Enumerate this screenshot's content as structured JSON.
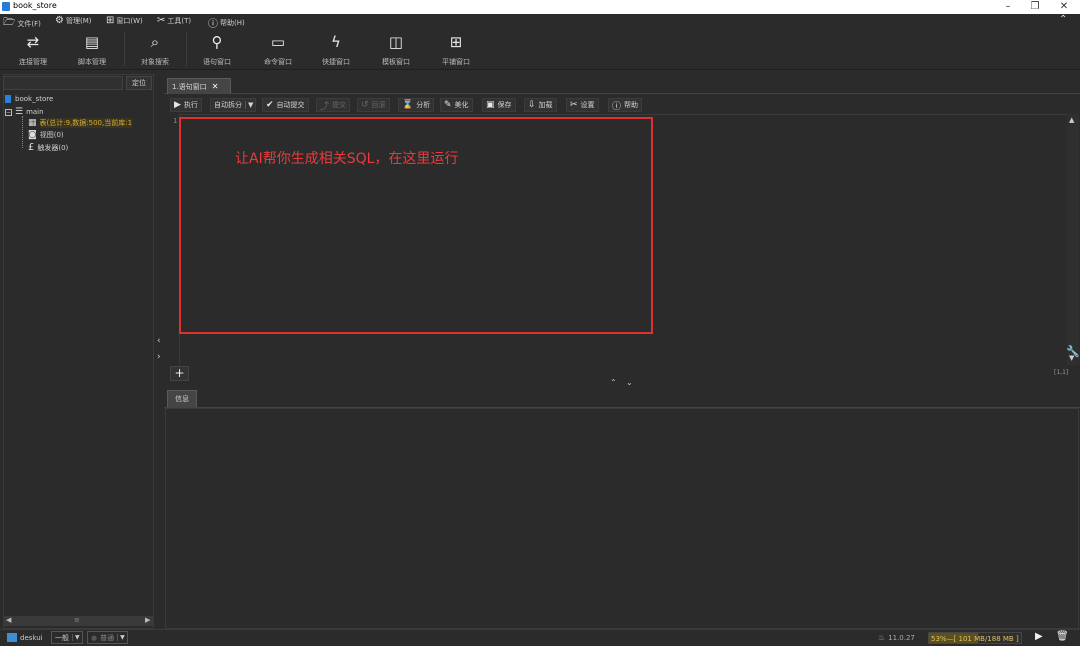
{
  "window": {
    "title": "book_store"
  },
  "menu": [
    {
      "icon": "folder-icon",
      "glyph": "🗁",
      "label": "文件(F)"
    },
    {
      "icon": "gear-icon",
      "glyph": "⚙",
      "label": "管理(M)"
    },
    {
      "icon": "windows-icon",
      "glyph": "⊞",
      "label": "窗口(W)"
    },
    {
      "icon": "tools-icon",
      "glyph": "✂",
      "label": "工具(T)"
    },
    {
      "icon": "help-icon",
      "glyph": "?",
      "label": "帮助(H)"
    }
  ],
  "toolbar": [
    {
      "icon": "connection-icon",
      "glyph": "⇄",
      "label": "连接管理"
    },
    {
      "icon": "script-icon",
      "glyph": "▤",
      "label": "脚本管理"
    },
    {
      "icon": "object-search-icon",
      "glyph": "⌕",
      "label": "对象搜索"
    },
    {
      "icon": "search-icon",
      "glyph": "🔍",
      "label": "语句窗口"
    },
    {
      "icon": "command-icon",
      "glyph": "▭",
      "label": "命令窗口"
    },
    {
      "icon": "lightning-icon",
      "glyph": "ϟ",
      "label": "快捷窗口"
    },
    {
      "icon": "template-icon",
      "glyph": "◫",
      "label": "模板窗口"
    },
    {
      "icon": "tile-icon",
      "glyph": "⊞",
      "label": "平铺窗口"
    }
  ],
  "left_panel": {
    "locate_label": "定位",
    "tree": {
      "db": "book_store",
      "schema": "main",
      "tables": "表(总计:9,数据:500,当前库:1",
      "views": "视图(0)",
      "triggers": "触发器(0)"
    }
  },
  "editor": {
    "tab_label": "1.语句窗口",
    "buttons": [
      {
        "icon": "play-icon",
        "glyph": "▶",
        "label": "执行",
        "disabled": false
      },
      {
        "icon": "split-icon",
        "glyph": "",
        "label": "自动拆分",
        "disabled": false
      },
      {
        "icon": "check-icon",
        "glyph": "✔",
        "label": "自动提交",
        "disabled": false
      },
      {
        "icon": "commit-icon",
        "glyph": "⤴",
        "label": "提交",
        "disabled": true
      },
      {
        "icon": "rollback-icon",
        "glyph": "↺",
        "label": "回滚",
        "disabled": true
      },
      {
        "icon": "analyze-icon",
        "glyph": "⌛",
        "label": "分析",
        "disabled": false
      },
      {
        "icon": "beautify-icon",
        "glyph": "✎",
        "label": "美化",
        "disabled": false
      },
      {
        "icon": "save-icon",
        "glyph": "💾",
        "label": "保存",
        "disabled": false
      },
      {
        "icon": "load-icon",
        "glyph": "⇩",
        "label": "加载",
        "disabled": false
      },
      {
        "icon": "settings-icon",
        "glyph": "✂",
        "label": "设置",
        "disabled": false
      },
      {
        "icon": "help-icon",
        "glyph": "?",
        "label": "帮助",
        "disabled": false
      }
    ],
    "line_number": "1",
    "annotation": "让AI帮你生成相关SQL，在这里运行",
    "cursor_pos": "[1,1]",
    "add_label": "+"
  },
  "result": {
    "tab_label": "信息"
  },
  "statusbar": {
    "user": "deskui",
    "mode": "一般",
    "role": "普通",
    "version": "11.0.27",
    "memory": "53%—[ 101 MB/188 MB ]"
  },
  "colors": {
    "accent_red": "#e03030",
    "bg": "#2b2b2b"
  }
}
